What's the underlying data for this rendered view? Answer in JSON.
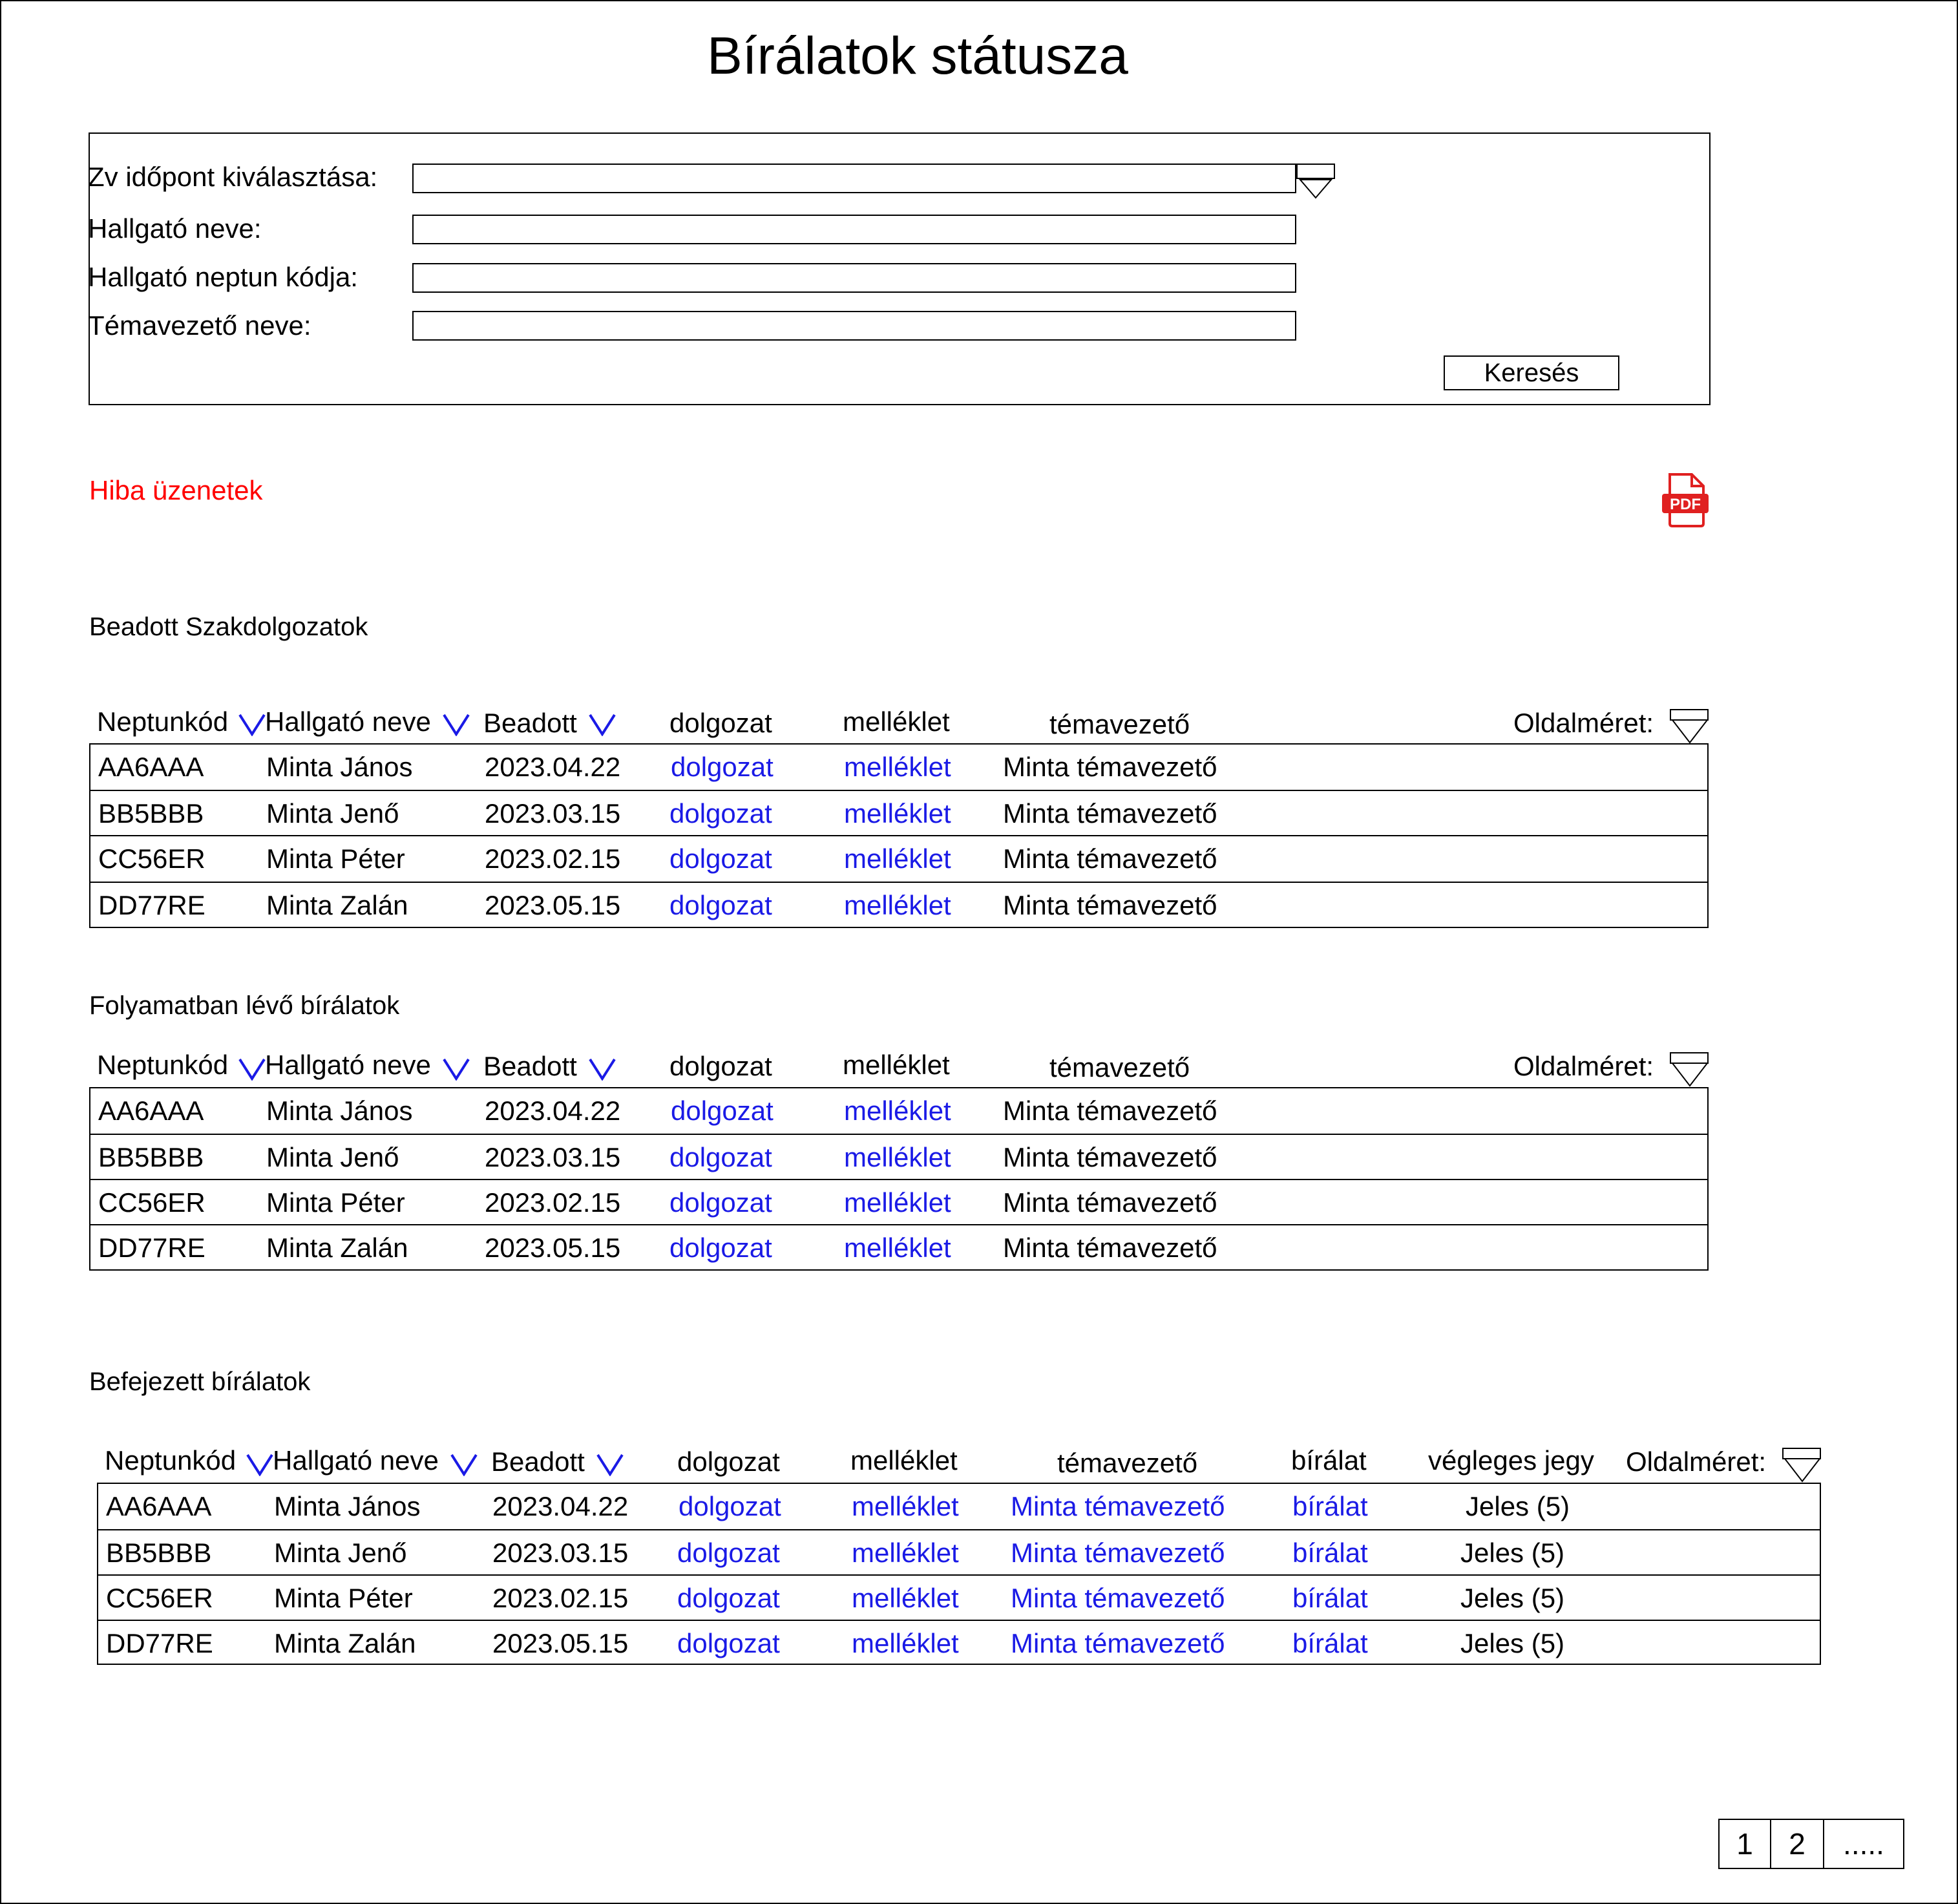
{
  "page": {
    "title": "Bírálatok státusza"
  },
  "search": {
    "exam_date_label": "Zv időpont kiválasztása:",
    "exam_date_value": "",
    "student_name_label": "Hallgató neve:",
    "student_name_value": "",
    "neptun_label": "Hallgató neptun kódja:",
    "neptun_value": "",
    "supervisor_label": "Témavezető neve:",
    "supervisor_value": "",
    "search_button": "Keresés"
  },
  "error_message": "Hiba üzenetek",
  "pdf_icon": {
    "name": "pdf-icon",
    "text": "PDF",
    "color": "#e02020"
  },
  "colors": {
    "link": "#1a1ae6",
    "error": "#ff0000",
    "sort_icon": "#1a1ae6"
  },
  "submitted": {
    "title": "Beadott Szakdolgozatok",
    "headers": {
      "neptun": "Neptunkód",
      "name": "Hallgató neve",
      "submitted": "Beadott",
      "thesis": "dolgozat",
      "attachment": "melléklet",
      "supervisor": "témavezető",
      "page_size": "Oldalméret:"
    },
    "rows": [
      {
        "neptun": "AA6AAA",
        "name": "Minta János",
        "date": "2023.04.22",
        "thesis": "dolgozat",
        "attachment": "melléklet",
        "supervisor": "Minta témavezető"
      },
      {
        "neptun": "BB5BBB",
        "name": "Minta Jenő",
        "date": "2023.03.15",
        "thesis": "dolgozat",
        "attachment": "melléklet",
        "supervisor": "Minta témavezető"
      },
      {
        "neptun": "CC56ER",
        "name": "Minta Péter",
        "date": "2023.02.15",
        "thesis": "dolgozat",
        "attachment": "melléklet",
        "supervisor": "Minta témavezető"
      },
      {
        "neptun": "DD77RE",
        "name": "Minta Zalán",
        "date": "2023.05.15",
        "thesis": "dolgozat",
        "attachment": "melléklet",
        "supervisor": "Minta témavezető"
      }
    ]
  },
  "in_progress": {
    "title": "Folyamatban lévő bírálatok",
    "headers": {
      "neptun": "Neptunkód",
      "name": "Hallgató neve",
      "submitted": "Beadott",
      "thesis": "dolgozat",
      "attachment": "melléklet",
      "supervisor": "témavezető",
      "page_size": "Oldalméret:"
    },
    "rows": [
      {
        "neptun": "AA6AAA",
        "name": "Minta János",
        "date": "2023.04.22",
        "thesis": "dolgozat",
        "attachment": "melléklet",
        "supervisor": "Minta témavezető"
      },
      {
        "neptun": "BB5BBB",
        "name": "Minta Jenő",
        "date": "2023.03.15",
        "thesis": "dolgozat",
        "attachment": "melléklet",
        "supervisor": "Minta témavezető"
      },
      {
        "neptun": "CC56ER",
        "name": "Minta Péter",
        "date": "2023.02.15",
        "thesis": "dolgozat",
        "attachment": "melléklet",
        "supervisor": "Minta témavezető"
      },
      {
        "neptun": "DD77RE",
        "name": "Minta Zalán",
        "date": "2023.05.15",
        "thesis": "dolgozat",
        "attachment": "melléklet",
        "supervisor": "Minta témavezető"
      }
    ]
  },
  "completed": {
    "title": "Befejezett bírálatok",
    "headers": {
      "neptun": "Neptunkód",
      "name": "Hallgató neve",
      "submitted": "Beadott",
      "thesis": "dolgozat",
      "attachment": "melléklet",
      "supervisor": "témavezető",
      "review": "bírálat",
      "final_grade": "végleges jegy",
      "page_size": "Oldalméret:"
    },
    "rows": [
      {
        "neptun": "AA6AAA",
        "name": "Minta János",
        "date": "2023.04.22",
        "thesis": "dolgozat",
        "attachment": "melléklet",
        "supervisor": "Minta témavezető",
        "review": "bírálat",
        "grade": "Jeles (5)"
      },
      {
        "neptun": "BB5BBB",
        "name": "Minta Jenő",
        "date": "2023.03.15",
        "thesis": "dolgozat",
        "attachment": "melléklet",
        "supervisor": "Minta témavezető",
        "review": "bírálat",
        "grade": "Jeles (5)"
      },
      {
        "neptun": "CC56ER",
        "name": "Minta Péter",
        "date": "2023.02.15",
        "thesis": "dolgozat",
        "attachment": "melléklet",
        "supervisor": "Minta témavezető",
        "review": "bírálat",
        "grade": "Jeles (5)"
      },
      {
        "neptun": "DD77RE",
        "name": "Minta Zalán",
        "date": "2023.05.15",
        "thesis": "dolgozat",
        "attachment": "melléklet",
        "supervisor": "Minta témavezető",
        "review": "bírálat",
        "grade": "Jeles (5)"
      }
    ]
  },
  "pagination": {
    "pages": [
      "1",
      "2"
    ],
    "more": "....."
  }
}
